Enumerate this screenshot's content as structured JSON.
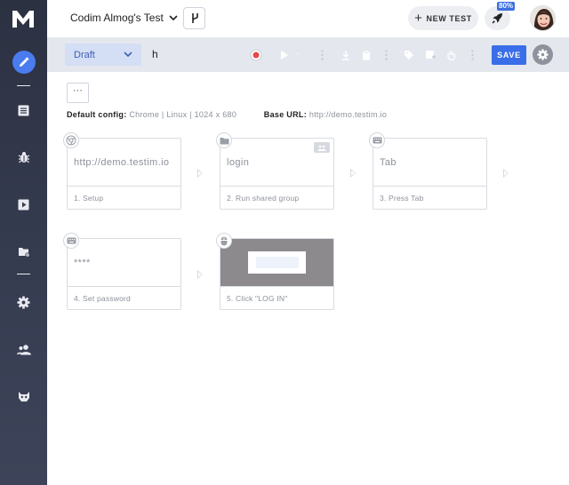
{
  "header": {
    "project_name": "Codim Almog's Test",
    "new_test_label": "NEW TEST",
    "progress_badge": "80%"
  },
  "toolbar": {
    "status_value": "Draft",
    "test_name": "h",
    "save_label": "SAVE"
  },
  "main": {
    "more_label": "···",
    "default_config_label": "Default config:",
    "default_config_value": "Chrome | Linux | 1024 x 680",
    "base_url_label": "Base URL:",
    "base_url_value": "http://demo.testim.io"
  },
  "steps": [
    {
      "text": "http://demo.testim.io",
      "label": "1. Setup",
      "icon": "chrome-icon"
    },
    {
      "text": "login",
      "label": "2. Run shared group",
      "icon": "folder-icon"
    },
    {
      "text": "Tab",
      "label": "3. Press Tab",
      "icon": "keyboard-icon"
    },
    {
      "text": "****",
      "label": "4. Set password",
      "icon": "keyboard-icon"
    },
    {
      "text": "",
      "label": "5. Click \"LOG IN\"",
      "icon": "mouse-icon"
    }
  ],
  "colors": {
    "sidebar": "#2c3142",
    "accent": "#3a6ee8",
    "toolbar": "#e4e7ee"
  }
}
